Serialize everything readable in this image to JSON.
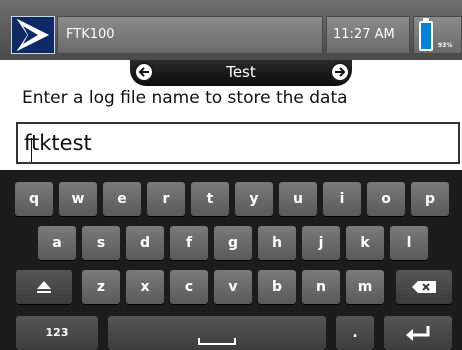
{
  "status": {
    "app_name": "FTK100",
    "time": "11:27 AM",
    "battery_percent": "93%",
    "battery_level": 0.93
  },
  "titlebar": {
    "title": "Test"
  },
  "prompt": {
    "text": "Enter a log file name to store the data"
  },
  "filename": {
    "value": "ftktest"
  },
  "keyboard": {
    "row1": [
      "q",
      "w",
      "e",
      "r",
      "t",
      "y",
      "u",
      "i",
      "o",
      "p"
    ],
    "row2": [
      "a",
      "s",
      "d",
      "f",
      "g",
      "h",
      "j",
      "k",
      "l"
    ],
    "row3": [
      "z",
      "x",
      "c",
      "v",
      "b",
      "n",
      "m"
    ],
    "numbers_label": "123",
    "period_label": ".",
    "icons": {
      "shift": "shift-icon",
      "backspace": "backspace-icon",
      "enter": "enter-icon",
      "space": "space-icon"
    }
  },
  "colors": {
    "accent": "#0e2a66",
    "battery": "#0a80d8",
    "statusbar": "#5a5a5a",
    "keyboard_bg": "#1c1c1c"
  }
}
